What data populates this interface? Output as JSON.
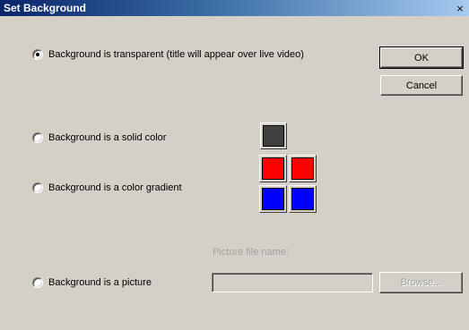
{
  "window": {
    "title": "Set Background",
    "close_glyph": "×"
  },
  "options": [
    {
      "label": "Background is transparent (title will appear over live video)",
      "checked": true
    },
    {
      "label": "Background is a solid color",
      "checked": false
    },
    {
      "label": "Background is a color gradient",
      "checked": false
    },
    {
      "label": "Background is a picture",
      "checked": false
    }
  ],
  "buttons": {
    "ok": "OK",
    "cancel": "Cancel",
    "browse": "Browse..."
  },
  "picture": {
    "field_label": "Picture file name:",
    "value": ""
  },
  "colors": {
    "solid": "#404040",
    "gradient_top_left": "#ff0000",
    "gradient_top_right": "#ff0000",
    "gradient_bottom_left": "#0000ff",
    "gradient_bottom_right": "#0000ff"
  }
}
